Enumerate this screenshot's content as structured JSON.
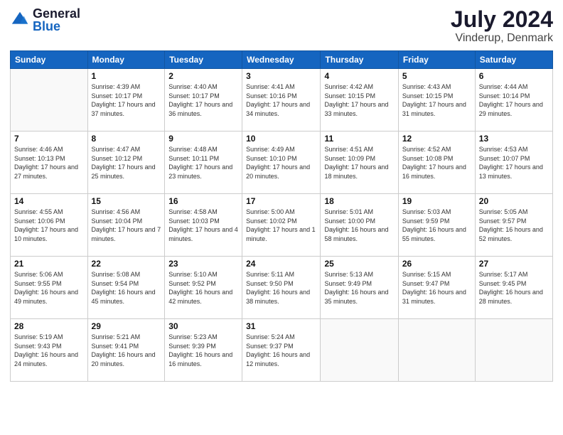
{
  "logo": {
    "general": "General",
    "blue": "Blue"
  },
  "title": {
    "month_year": "July 2024",
    "location": "Vinderup, Denmark"
  },
  "headers": [
    "Sunday",
    "Monday",
    "Tuesday",
    "Wednesday",
    "Thursday",
    "Friday",
    "Saturday"
  ],
  "weeks": [
    [
      {
        "day": "",
        "info": ""
      },
      {
        "day": "1",
        "info": "Sunrise: 4:39 AM\nSunset: 10:17 PM\nDaylight: 17 hours\nand 37 minutes."
      },
      {
        "day": "2",
        "info": "Sunrise: 4:40 AM\nSunset: 10:17 PM\nDaylight: 17 hours\nand 36 minutes."
      },
      {
        "day": "3",
        "info": "Sunrise: 4:41 AM\nSunset: 10:16 PM\nDaylight: 17 hours\nand 34 minutes."
      },
      {
        "day": "4",
        "info": "Sunrise: 4:42 AM\nSunset: 10:15 PM\nDaylight: 17 hours\nand 33 minutes."
      },
      {
        "day": "5",
        "info": "Sunrise: 4:43 AM\nSunset: 10:15 PM\nDaylight: 17 hours\nand 31 minutes."
      },
      {
        "day": "6",
        "info": "Sunrise: 4:44 AM\nSunset: 10:14 PM\nDaylight: 17 hours\nand 29 minutes."
      }
    ],
    [
      {
        "day": "7",
        "info": "Sunrise: 4:46 AM\nSunset: 10:13 PM\nDaylight: 17 hours\nand 27 minutes."
      },
      {
        "day": "8",
        "info": "Sunrise: 4:47 AM\nSunset: 10:12 PM\nDaylight: 17 hours\nand 25 minutes."
      },
      {
        "day": "9",
        "info": "Sunrise: 4:48 AM\nSunset: 10:11 PM\nDaylight: 17 hours\nand 23 minutes."
      },
      {
        "day": "10",
        "info": "Sunrise: 4:49 AM\nSunset: 10:10 PM\nDaylight: 17 hours\nand 20 minutes."
      },
      {
        "day": "11",
        "info": "Sunrise: 4:51 AM\nSunset: 10:09 PM\nDaylight: 17 hours\nand 18 minutes."
      },
      {
        "day": "12",
        "info": "Sunrise: 4:52 AM\nSunset: 10:08 PM\nDaylight: 17 hours\nand 16 minutes."
      },
      {
        "day": "13",
        "info": "Sunrise: 4:53 AM\nSunset: 10:07 PM\nDaylight: 17 hours\nand 13 minutes."
      }
    ],
    [
      {
        "day": "14",
        "info": "Sunrise: 4:55 AM\nSunset: 10:06 PM\nDaylight: 17 hours\nand 10 minutes."
      },
      {
        "day": "15",
        "info": "Sunrise: 4:56 AM\nSunset: 10:04 PM\nDaylight: 17 hours\nand 7 minutes."
      },
      {
        "day": "16",
        "info": "Sunrise: 4:58 AM\nSunset: 10:03 PM\nDaylight: 17 hours\nand 4 minutes."
      },
      {
        "day": "17",
        "info": "Sunrise: 5:00 AM\nSunset: 10:02 PM\nDaylight: 17 hours\nand 1 minute."
      },
      {
        "day": "18",
        "info": "Sunrise: 5:01 AM\nSunset: 10:00 PM\nDaylight: 16 hours\nand 58 minutes."
      },
      {
        "day": "19",
        "info": "Sunrise: 5:03 AM\nSunset: 9:59 PM\nDaylight: 16 hours\nand 55 minutes."
      },
      {
        "day": "20",
        "info": "Sunrise: 5:05 AM\nSunset: 9:57 PM\nDaylight: 16 hours\nand 52 minutes."
      }
    ],
    [
      {
        "day": "21",
        "info": "Sunrise: 5:06 AM\nSunset: 9:55 PM\nDaylight: 16 hours\nand 49 minutes."
      },
      {
        "day": "22",
        "info": "Sunrise: 5:08 AM\nSunset: 9:54 PM\nDaylight: 16 hours\nand 45 minutes."
      },
      {
        "day": "23",
        "info": "Sunrise: 5:10 AM\nSunset: 9:52 PM\nDaylight: 16 hours\nand 42 minutes."
      },
      {
        "day": "24",
        "info": "Sunrise: 5:11 AM\nSunset: 9:50 PM\nDaylight: 16 hours\nand 38 minutes."
      },
      {
        "day": "25",
        "info": "Sunrise: 5:13 AM\nSunset: 9:49 PM\nDaylight: 16 hours\nand 35 minutes."
      },
      {
        "day": "26",
        "info": "Sunrise: 5:15 AM\nSunset: 9:47 PM\nDaylight: 16 hours\nand 31 minutes."
      },
      {
        "day": "27",
        "info": "Sunrise: 5:17 AM\nSunset: 9:45 PM\nDaylight: 16 hours\nand 28 minutes."
      }
    ],
    [
      {
        "day": "28",
        "info": "Sunrise: 5:19 AM\nSunset: 9:43 PM\nDaylight: 16 hours\nand 24 minutes."
      },
      {
        "day": "29",
        "info": "Sunrise: 5:21 AM\nSunset: 9:41 PM\nDaylight: 16 hours\nand 20 minutes."
      },
      {
        "day": "30",
        "info": "Sunrise: 5:23 AM\nSunset: 9:39 PM\nDaylight: 16 hours\nand 16 minutes."
      },
      {
        "day": "31",
        "info": "Sunrise: 5:24 AM\nSunset: 9:37 PM\nDaylight: 16 hours\nand 12 minutes."
      },
      {
        "day": "",
        "info": ""
      },
      {
        "day": "",
        "info": ""
      },
      {
        "day": "",
        "info": ""
      }
    ]
  ]
}
